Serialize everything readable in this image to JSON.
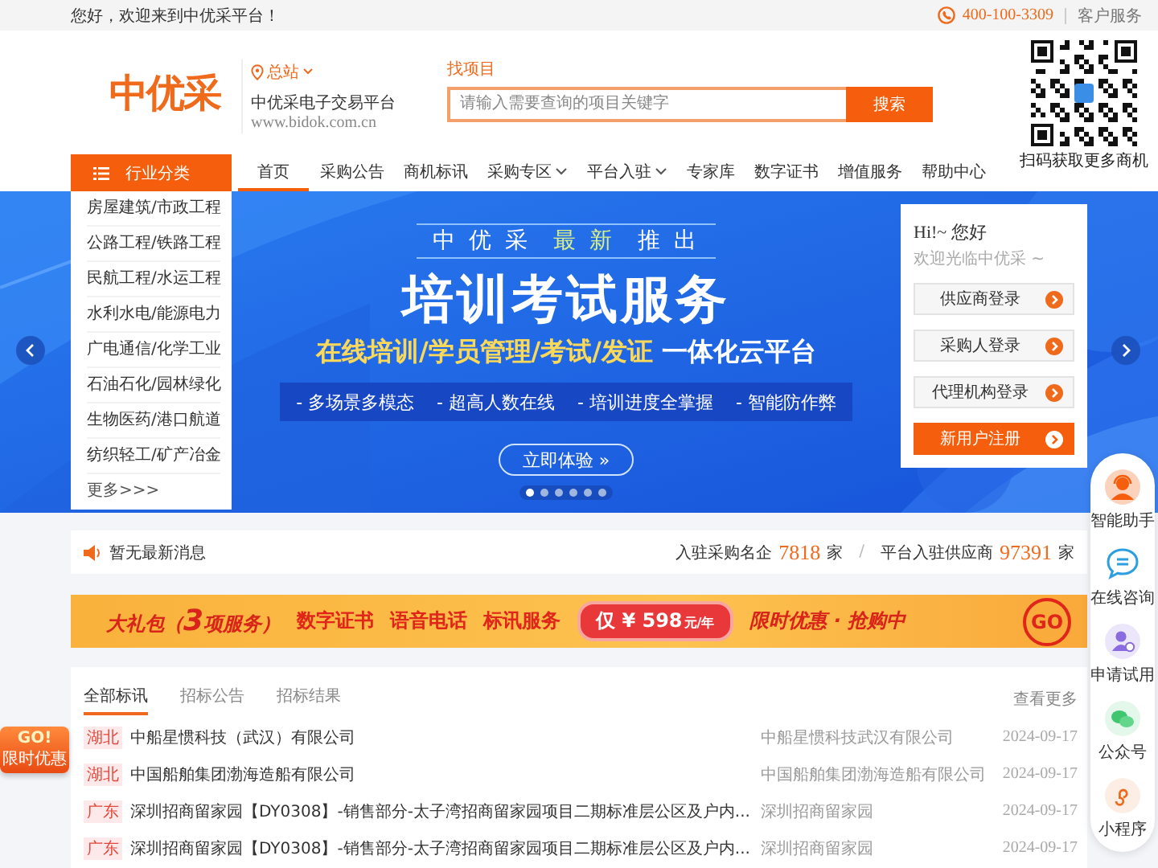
{
  "top_bar": {
    "greeting": "您好，欢迎来到中优采平台！",
    "phone": "400-100-3309",
    "service": "客户服务"
  },
  "header": {
    "logo": "中优采",
    "location": "总站",
    "platform_name": "中优采电子交易平台",
    "url": "www.bidok.com.cn",
    "search": {
      "label": "找项目",
      "placeholder": "请输入需要查询的项目关键字",
      "button": "搜索"
    },
    "qr_caption": "扫码获取更多商机"
  },
  "nav": {
    "category_button": "行业分类",
    "items": [
      {
        "label": "首页",
        "selected": true,
        "dropdown": false
      },
      {
        "label": "采购公告",
        "selected": false,
        "dropdown": false
      },
      {
        "label": "商机标讯",
        "selected": false,
        "dropdown": false
      },
      {
        "label": "采购专区",
        "selected": false,
        "dropdown": true
      },
      {
        "label": "平台入驻",
        "selected": false,
        "dropdown": true
      },
      {
        "label": "专家库",
        "selected": false,
        "dropdown": false
      },
      {
        "label": "数字证书",
        "selected": false,
        "dropdown": false
      },
      {
        "label": "增值服务",
        "selected": false,
        "dropdown": false
      },
      {
        "label": "帮助中心",
        "selected": false,
        "dropdown": false
      }
    ]
  },
  "categories": [
    "房屋建筑/市政工程",
    "公路工程/铁路工程",
    "民航工程/水运工程",
    "水利水电/能源电力",
    "广电通信/化学工业",
    "石油石化/园林绿化",
    "生物医药/港口航道",
    "纺织轻工/矿产冶金"
  ],
  "categories_more": "更多>>>",
  "banner": {
    "tagline": [
      {
        "text": "中 优 采",
        "highlight": false
      },
      {
        "text": "最 新",
        "highlight": true
      },
      {
        "text": "推 出",
        "highlight": false
      }
    ],
    "title": "培训考试服务",
    "subtitle_highlight": "在线培训/学员管理/考试/发证",
    "subtitle": "一体化云平台",
    "features": [
      "- 多场景多模态",
      "- 超高人数在线",
      "- 培训进度全掌握",
      "- 智能防作弊"
    ],
    "cta": "立即体验 »",
    "slides": [
      {
        "selected": true
      },
      {
        "selected": false
      },
      {
        "selected": false
      },
      {
        "selected": false
      },
      {
        "selected": false
      },
      {
        "selected": false
      }
    ]
  },
  "login_card": {
    "greeting": "Hi!~ 您好",
    "welcome": "欢迎光临中优采 ~",
    "buttons": [
      {
        "label": "供应商登录",
        "kind": "secondary"
      },
      {
        "label": "采购人登录",
        "kind": "secondary"
      },
      {
        "label": "代理机构登录",
        "kind": "secondary"
      },
      {
        "label": "新用户注册",
        "kind": "primary"
      }
    ]
  },
  "notice": {
    "message": "暂无最新消息",
    "separator": "/",
    "stats": [
      {
        "label": "入驻采购名企",
        "value": "7818",
        "unit": "家"
      },
      {
        "label": "平台入驻供应商",
        "value": "97391",
        "unit": "家"
      }
    ]
  },
  "promo": {
    "package": "大礼包（",
    "count": "3",
    "package_end": "项服务）",
    "services": [
      "数字证书",
      "语音电话",
      "标讯服务"
    ],
    "price": "仅 ¥ 598",
    "price_unit": "元/年",
    "offer": "限时优惠 · 抢购中",
    "go": "GO"
  },
  "float_badge": {
    "go": "GO!",
    "label": "限时优惠"
  },
  "listing": {
    "tabs": [
      {
        "label": "全部标讯",
        "selected": true
      },
      {
        "label": "招标公告",
        "selected": false
      },
      {
        "label": "招标结果",
        "selected": false
      }
    ],
    "more": "查看更多",
    "rows": [
      {
        "region": "湖北",
        "title": "中船星惯科技（武汉）有限公司",
        "company": "中船星惯科技武汉有限公司",
        "date": "2024-09-17"
      },
      {
        "region": "湖北",
        "title": "中国船舶集团渤海造船有限公司",
        "company": "中国船舶集团渤海造船有限公司",
        "date": "2024-09-17"
      },
      {
        "region": "广东",
        "title": "深圳招商留家园【DY0308】-销售部分-太子湾招商留家园项目二期标准层公区及户内...",
        "company": "深圳招商留家园",
        "date": "2024-09-17"
      },
      {
        "region": "广东",
        "title": "深圳招商留家园【DY0308】-销售部分-太子湾招商留家园项目二期标准层公区及户内...",
        "company": "深圳招商留家园",
        "date": "2024-09-17"
      }
    ]
  },
  "side_toolbar": [
    {
      "label": "智能助手",
      "kind": "assistant"
    },
    {
      "label": "在线咨询",
      "kind": "chat"
    },
    {
      "label": "申请试用",
      "kind": "trial"
    },
    {
      "label": "公众号",
      "kind": "wechat"
    },
    {
      "label": "小程序",
      "kind": "miniapp"
    }
  ]
}
